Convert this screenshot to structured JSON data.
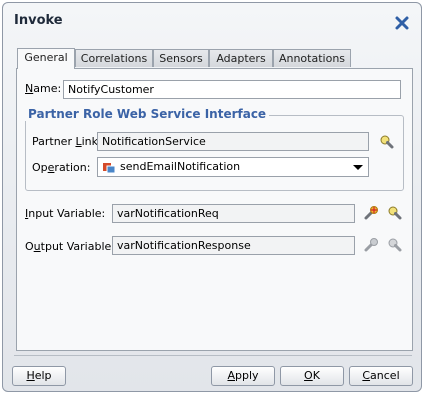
{
  "dialog": {
    "title": "Invoke"
  },
  "tabs": [
    {
      "label": "General",
      "active": true
    },
    {
      "label": "Correlations",
      "active": false
    },
    {
      "label": "Sensors",
      "active": false
    },
    {
      "label": "Adapters",
      "active": false
    },
    {
      "label": "Annotations",
      "active": false
    }
  ],
  "general": {
    "name_label_u": "N",
    "name_label_rest": "ame:",
    "name_value": "NotifyCustomer",
    "group_title": "Partner Role Web Service Interface",
    "partner_link_label_a": "Partner ",
    "partner_link_label_u": "L",
    "partner_link_label_b": "ink:",
    "partner_link_value": "NotificationService",
    "operation_label_a": "Op",
    "operation_label_u": "e",
    "operation_label_b": "ration:",
    "operation_value": "sendEmailNotification",
    "input_label_u": "I",
    "input_label_rest": "nput Variable:",
    "input_value": "varNotificationReq",
    "output_label_a": "O",
    "output_label_u": "u",
    "output_label_b": "tput Variable:",
    "output_value": "varNotificationResponse"
  },
  "buttons": {
    "help_u": "H",
    "help_rest": "elp",
    "apply_u": "A",
    "apply_rest": "pply",
    "ok_u": "O",
    "ok_rest": "K",
    "cancel_u": "C",
    "cancel_rest": "ancel"
  },
  "icons": {
    "close": "close-icon",
    "partner_link_browse": "flashlight-icon",
    "operation": "operation-icon",
    "input_create": "create-variable-icon",
    "input_browse": "flashlight-icon",
    "output_create": "create-variable-icon-disabled",
    "output_browse": "flashlight-icon-disabled"
  },
  "colors": {
    "accent": "#3b63a6",
    "close": "#2f5fa6"
  }
}
